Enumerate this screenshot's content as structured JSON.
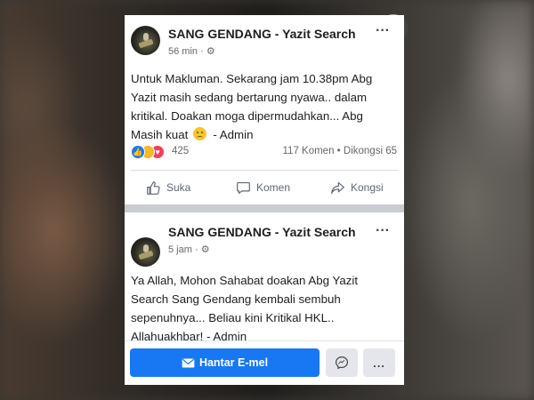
{
  "post1": {
    "author": "SANG GENDANG - Yazit Search",
    "time": "56 min",
    "privacy_icon": "gear-icon",
    "lines": [
      "Untuk Makluman. Sekarang jam 10.38pm Abg",
      "Yazit masih sedang bertarung nyawa.. dalam",
      "kritikal. Doakan moga dipermudahkan... Abg",
      "Masih kuat"
    ],
    "line4_suffix": "- Admin",
    "reaction_count": "425",
    "comments": "117 Komen",
    "separator": "•",
    "shares": "Dikongsi 65",
    "like_label": "Suka",
    "comment_label": "Komen",
    "share_label": "Kongsi"
  },
  "post2": {
    "author": "SANG GENDANG - Yazit Search",
    "time": "5 jam",
    "privacy_icon": "gear-icon",
    "lines": [
      "Ya Allah, Mohon Sahabat doakan Abg Yazit",
      "Search Sang Gendang kembali sembuh",
      "sepenuhnya... Beliau kini Kritikal HKL..",
      "Allahuakhbar! - Admin"
    ]
  },
  "footer": {
    "email_label": "Hantar E-mel",
    "more_label": "..."
  },
  "colors": {
    "accent": "#1877f2",
    "muted_text": "#65676b",
    "divider": "#dadde1"
  }
}
